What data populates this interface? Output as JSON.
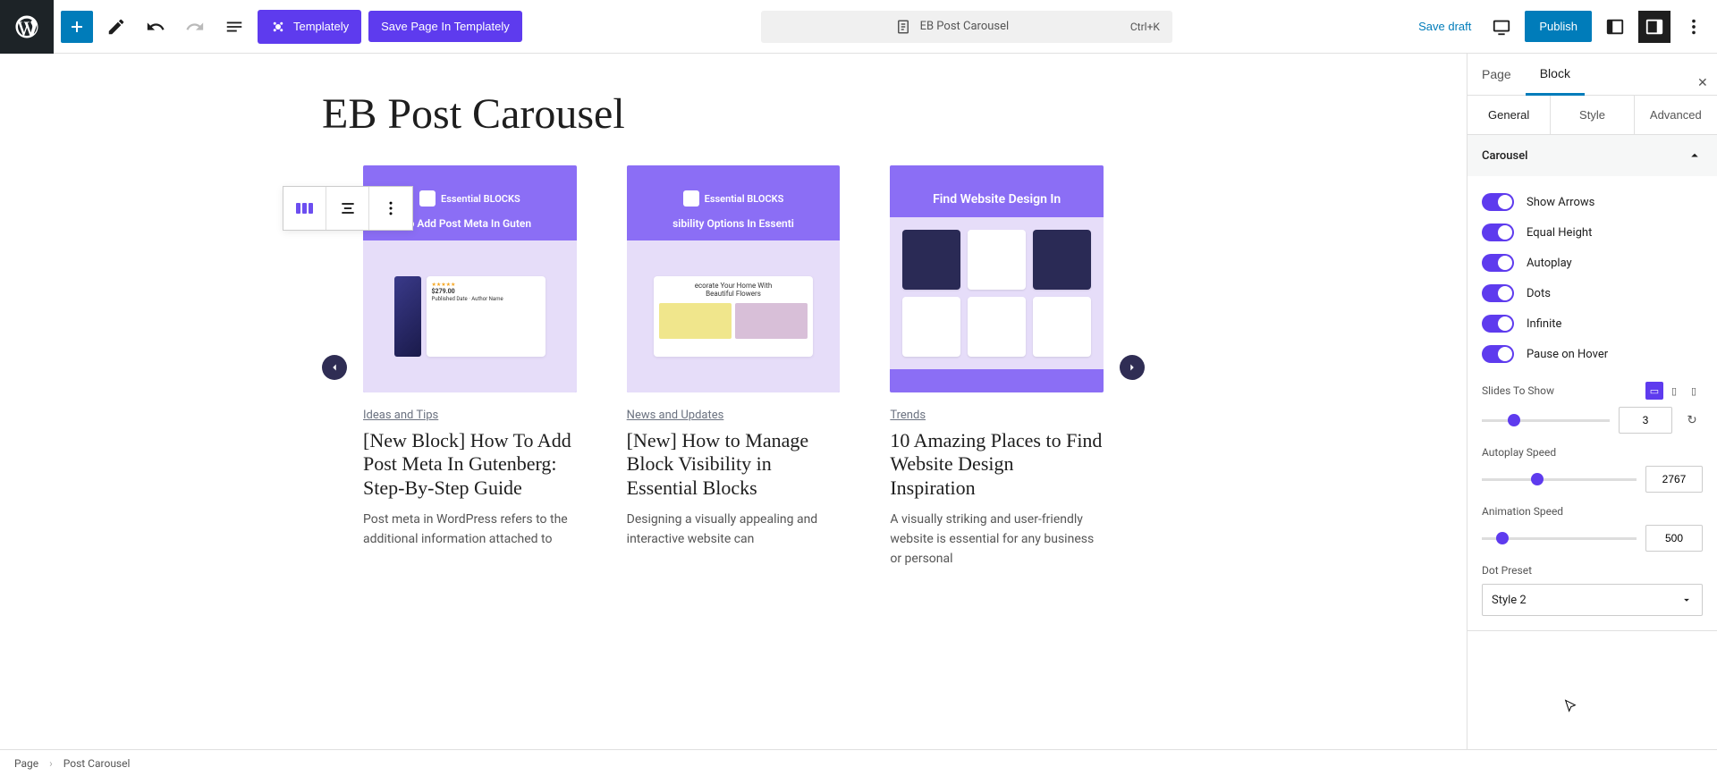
{
  "topbar": {
    "templately_label": "Templately",
    "save_templately_label": "Save Page In Templately",
    "doc_title": "EB Post Carousel",
    "shortcut": "Ctrl+K",
    "save_draft": "Save draft",
    "publish": "Publish"
  },
  "canvas": {
    "page_title": "EB Post Carousel",
    "slides": [
      {
        "hero_badge": "Essential BLOCKS",
        "hero_text": "o Add Post Meta In Guten",
        "category": "Ideas and Tips",
        "title": "[New Block] How To Add Post Meta In Gutenberg: Step-By-Step Guide",
        "excerpt": "Post meta in WordPress refers to the additional information attached to"
      },
      {
        "hero_badge": "Essential BLOCKS",
        "hero_text": "sibility Options In Essenti",
        "category": "News and Updates",
        "title": "[New] How to Manage Block Visibility in Essential Blocks",
        "excerpt": "Designing a visually appealing and interactive website can"
      },
      {
        "hero_badge": "",
        "hero_text": "Find Website Design In",
        "category": "Trends",
        "title": "10 Amazing Places to Find Website Design Inspiration",
        "excerpt": "A visually striking and user-friendly website is essential for any business or personal"
      }
    ]
  },
  "sidebar": {
    "tabs": {
      "page": "Page",
      "block": "Block"
    },
    "subtabs": {
      "general": "General",
      "style": "Style",
      "advanced": "Advanced"
    },
    "panel_title": "Carousel",
    "toggles": {
      "show_arrows": "Show Arrows",
      "equal_height": "Equal Height",
      "autoplay": "Autoplay",
      "dots": "Dots",
      "infinite": "Infinite",
      "pause_hover": "Pause on Hover"
    },
    "slides_to_show": {
      "label": "Slides To Show",
      "value": "3"
    },
    "autoplay_speed": {
      "label": "Autoplay Speed",
      "value": "2767"
    },
    "animation_speed": {
      "label": "Animation Speed",
      "value": "500"
    },
    "dot_preset": {
      "label": "Dot Preset",
      "value": "Style 2"
    }
  },
  "footer": {
    "page": "Page",
    "current": "Post Carousel"
  }
}
